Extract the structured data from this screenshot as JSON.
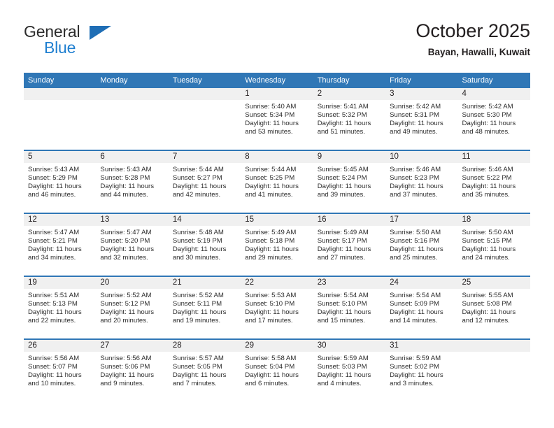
{
  "brand": {
    "name_part1": "General",
    "name_part2": "Blue",
    "accent_color": "#1f7fd0",
    "header_color": "#3077b6"
  },
  "header": {
    "title": "October 2025",
    "location": "Bayan, Hawalli, Kuwait"
  },
  "weekdays": [
    "Sunday",
    "Monday",
    "Tuesday",
    "Wednesday",
    "Thursday",
    "Friday",
    "Saturday"
  ],
  "weeks": [
    [
      {
        "date": "",
        "sunrise": "",
        "sunset": "",
        "daylight1": "",
        "daylight2": ""
      },
      {
        "date": "",
        "sunrise": "",
        "sunset": "",
        "daylight1": "",
        "daylight2": ""
      },
      {
        "date": "",
        "sunrise": "",
        "sunset": "",
        "daylight1": "",
        "daylight2": ""
      },
      {
        "date": "1",
        "sunrise": "Sunrise: 5:40 AM",
        "sunset": "Sunset: 5:34 PM",
        "daylight1": "Daylight: 11 hours",
        "daylight2": "and 53 minutes."
      },
      {
        "date": "2",
        "sunrise": "Sunrise: 5:41 AM",
        "sunset": "Sunset: 5:32 PM",
        "daylight1": "Daylight: 11 hours",
        "daylight2": "and 51 minutes."
      },
      {
        "date": "3",
        "sunrise": "Sunrise: 5:42 AM",
        "sunset": "Sunset: 5:31 PM",
        "daylight1": "Daylight: 11 hours",
        "daylight2": "and 49 minutes."
      },
      {
        "date": "4",
        "sunrise": "Sunrise: 5:42 AM",
        "sunset": "Sunset: 5:30 PM",
        "daylight1": "Daylight: 11 hours",
        "daylight2": "and 48 minutes."
      }
    ],
    [
      {
        "date": "5",
        "sunrise": "Sunrise: 5:43 AM",
        "sunset": "Sunset: 5:29 PM",
        "daylight1": "Daylight: 11 hours",
        "daylight2": "and 46 minutes."
      },
      {
        "date": "6",
        "sunrise": "Sunrise: 5:43 AM",
        "sunset": "Sunset: 5:28 PM",
        "daylight1": "Daylight: 11 hours",
        "daylight2": "and 44 minutes."
      },
      {
        "date": "7",
        "sunrise": "Sunrise: 5:44 AM",
        "sunset": "Sunset: 5:27 PM",
        "daylight1": "Daylight: 11 hours",
        "daylight2": "and 42 minutes."
      },
      {
        "date": "8",
        "sunrise": "Sunrise: 5:44 AM",
        "sunset": "Sunset: 5:25 PM",
        "daylight1": "Daylight: 11 hours",
        "daylight2": "and 41 minutes."
      },
      {
        "date": "9",
        "sunrise": "Sunrise: 5:45 AM",
        "sunset": "Sunset: 5:24 PM",
        "daylight1": "Daylight: 11 hours",
        "daylight2": "and 39 minutes."
      },
      {
        "date": "10",
        "sunrise": "Sunrise: 5:46 AM",
        "sunset": "Sunset: 5:23 PM",
        "daylight1": "Daylight: 11 hours",
        "daylight2": "and 37 minutes."
      },
      {
        "date": "11",
        "sunrise": "Sunrise: 5:46 AM",
        "sunset": "Sunset: 5:22 PM",
        "daylight1": "Daylight: 11 hours",
        "daylight2": "and 35 minutes."
      }
    ],
    [
      {
        "date": "12",
        "sunrise": "Sunrise: 5:47 AM",
        "sunset": "Sunset: 5:21 PM",
        "daylight1": "Daylight: 11 hours",
        "daylight2": "and 34 minutes."
      },
      {
        "date": "13",
        "sunrise": "Sunrise: 5:47 AM",
        "sunset": "Sunset: 5:20 PM",
        "daylight1": "Daylight: 11 hours",
        "daylight2": "and 32 minutes."
      },
      {
        "date": "14",
        "sunrise": "Sunrise: 5:48 AM",
        "sunset": "Sunset: 5:19 PM",
        "daylight1": "Daylight: 11 hours",
        "daylight2": "and 30 minutes."
      },
      {
        "date": "15",
        "sunrise": "Sunrise: 5:49 AM",
        "sunset": "Sunset: 5:18 PM",
        "daylight1": "Daylight: 11 hours",
        "daylight2": "and 29 minutes."
      },
      {
        "date": "16",
        "sunrise": "Sunrise: 5:49 AM",
        "sunset": "Sunset: 5:17 PM",
        "daylight1": "Daylight: 11 hours",
        "daylight2": "and 27 minutes."
      },
      {
        "date": "17",
        "sunrise": "Sunrise: 5:50 AM",
        "sunset": "Sunset: 5:16 PM",
        "daylight1": "Daylight: 11 hours",
        "daylight2": "and 25 minutes."
      },
      {
        "date": "18",
        "sunrise": "Sunrise: 5:50 AM",
        "sunset": "Sunset: 5:15 PM",
        "daylight1": "Daylight: 11 hours",
        "daylight2": "and 24 minutes."
      }
    ],
    [
      {
        "date": "19",
        "sunrise": "Sunrise: 5:51 AM",
        "sunset": "Sunset: 5:13 PM",
        "daylight1": "Daylight: 11 hours",
        "daylight2": "and 22 minutes."
      },
      {
        "date": "20",
        "sunrise": "Sunrise: 5:52 AM",
        "sunset": "Sunset: 5:12 PM",
        "daylight1": "Daylight: 11 hours",
        "daylight2": "and 20 minutes."
      },
      {
        "date": "21",
        "sunrise": "Sunrise: 5:52 AM",
        "sunset": "Sunset: 5:11 PM",
        "daylight1": "Daylight: 11 hours",
        "daylight2": "and 19 minutes."
      },
      {
        "date": "22",
        "sunrise": "Sunrise: 5:53 AM",
        "sunset": "Sunset: 5:10 PM",
        "daylight1": "Daylight: 11 hours",
        "daylight2": "and 17 minutes."
      },
      {
        "date": "23",
        "sunrise": "Sunrise: 5:54 AM",
        "sunset": "Sunset: 5:10 PM",
        "daylight1": "Daylight: 11 hours",
        "daylight2": "and 15 minutes."
      },
      {
        "date": "24",
        "sunrise": "Sunrise: 5:54 AM",
        "sunset": "Sunset: 5:09 PM",
        "daylight1": "Daylight: 11 hours",
        "daylight2": "and 14 minutes."
      },
      {
        "date": "25",
        "sunrise": "Sunrise: 5:55 AM",
        "sunset": "Sunset: 5:08 PM",
        "daylight1": "Daylight: 11 hours",
        "daylight2": "and 12 minutes."
      }
    ],
    [
      {
        "date": "26",
        "sunrise": "Sunrise: 5:56 AM",
        "sunset": "Sunset: 5:07 PM",
        "daylight1": "Daylight: 11 hours",
        "daylight2": "and 10 minutes."
      },
      {
        "date": "27",
        "sunrise": "Sunrise: 5:56 AM",
        "sunset": "Sunset: 5:06 PM",
        "daylight1": "Daylight: 11 hours",
        "daylight2": "and 9 minutes."
      },
      {
        "date": "28",
        "sunrise": "Sunrise: 5:57 AM",
        "sunset": "Sunset: 5:05 PM",
        "daylight1": "Daylight: 11 hours",
        "daylight2": "and 7 minutes."
      },
      {
        "date": "29",
        "sunrise": "Sunrise: 5:58 AM",
        "sunset": "Sunset: 5:04 PM",
        "daylight1": "Daylight: 11 hours",
        "daylight2": "and 6 minutes."
      },
      {
        "date": "30",
        "sunrise": "Sunrise: 5:59 AM",
        "sunset": "Sunset: 5:03 PM",
        "daylight1": "Daylight: 11 hours",
        "daylight2": "and 4 minutes."
      },
      {
        "date": "31",
        "sunrise": "Sunrise: 5:59 AM",
        "sunset": "Sunset: 5:02 PM",
        "daylight1": "Daylight: 11 hours",
        "daylight2": "and 3 minutes."
      },
      {
        "date": "",
        "sunrise": "",
        "sunset": "",
        "daylight1": "",
        "daylight2": ""
      }
    ]
  ]
}
